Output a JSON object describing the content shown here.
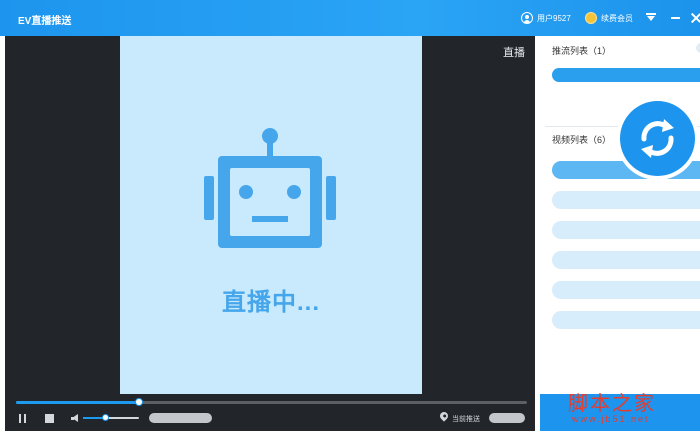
{
  "app": {
    "title": "EV直播推送"
  },
  "header": {
    "user_label": "用户9527",
    "vip_label": "续费会员"
  },
  "player": {
    "corner_label": "直播",
    "status_text": "直播中...",
    "progress_fraction": 0.24,
    "volume_fraction": 0.4,
    "current_push_label": "当前推送"
  },
  "panel": {
    "push_list_title": "推流列表（1）",
    "video_list_title": "视频列表（6）",
    "video_rows": [
      {
        "active": true
      },
      {
        "active": false
      },
      {
        "active": false
      },
      {
        "active": false
      },
      {
        "active": false
      },
      {
        "active": false
      }
    ]
  },
  "watermark": {
    "text": "脚本之家",
    "url": "www.jb51.net"
  },
  "colors": {
    "accent": "#1d95ee",
    "canvas": "#c8eafc",
    "player_bg": "#222529",
    "robot": "#46a6eb"
  }
}
